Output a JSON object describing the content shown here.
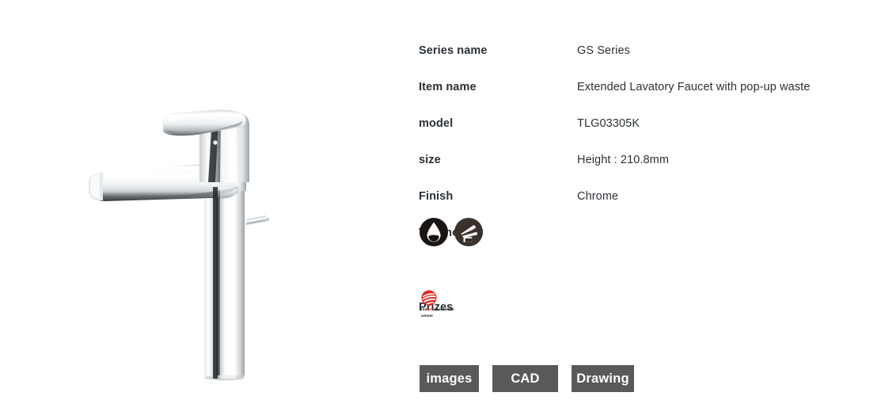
{
  "product": {
    "image_alt": "chrome extended lavatory faucet",
    "icon_name": "faucet-product-photo"
  },
  "specs": {
    "rows": [
      {
        "label": "Series name",
        "value": "GS Series"
      },
      {
        "label": "Item name",
        "value": "Extended Lavatory Faucet with pop-up waste"
      },
      {
        "label": "model",
        "value": "TLG03305K"
      },
      {
        "label": "size",
        "value": "Height : 210.8mm"
      },
      {
        "label": "Finish",
        "value": "Chrome"
      }
    ]
  },
  "technology": {
    "heading": "Technology",
    "icons": [
      {
        "name": "water-drop-icon",
        "label": "Water saving"
      },
      {
        "name": "faucet-spout-icon",
        "label": "Comfort wave / spout"
      }
    ]
  },
  "prizes": {
    "heading": "Prizes",
    "awards": [
      {
        "name": "reddot-award-logo",
        "caption_prefix": "red",
        "caption_dot": "dot",
        "caption_suffix": " award 2018",
        "caption_line2": "winner"
      }
    ]
  },
  "buttons": {
    "images_label": "images",
    "cad_label": "CAD",
    "drawing_label": "Drawing"
  },
  "colors": {
    "text": "#2b3137",
    "button_bg": "#595959",
    "button_text": "#ffffff",
    "reddot_red": "#e2231a",
    "icon_black": "#1a1512",
    "page_bg": "#ffffff"
  }
}
